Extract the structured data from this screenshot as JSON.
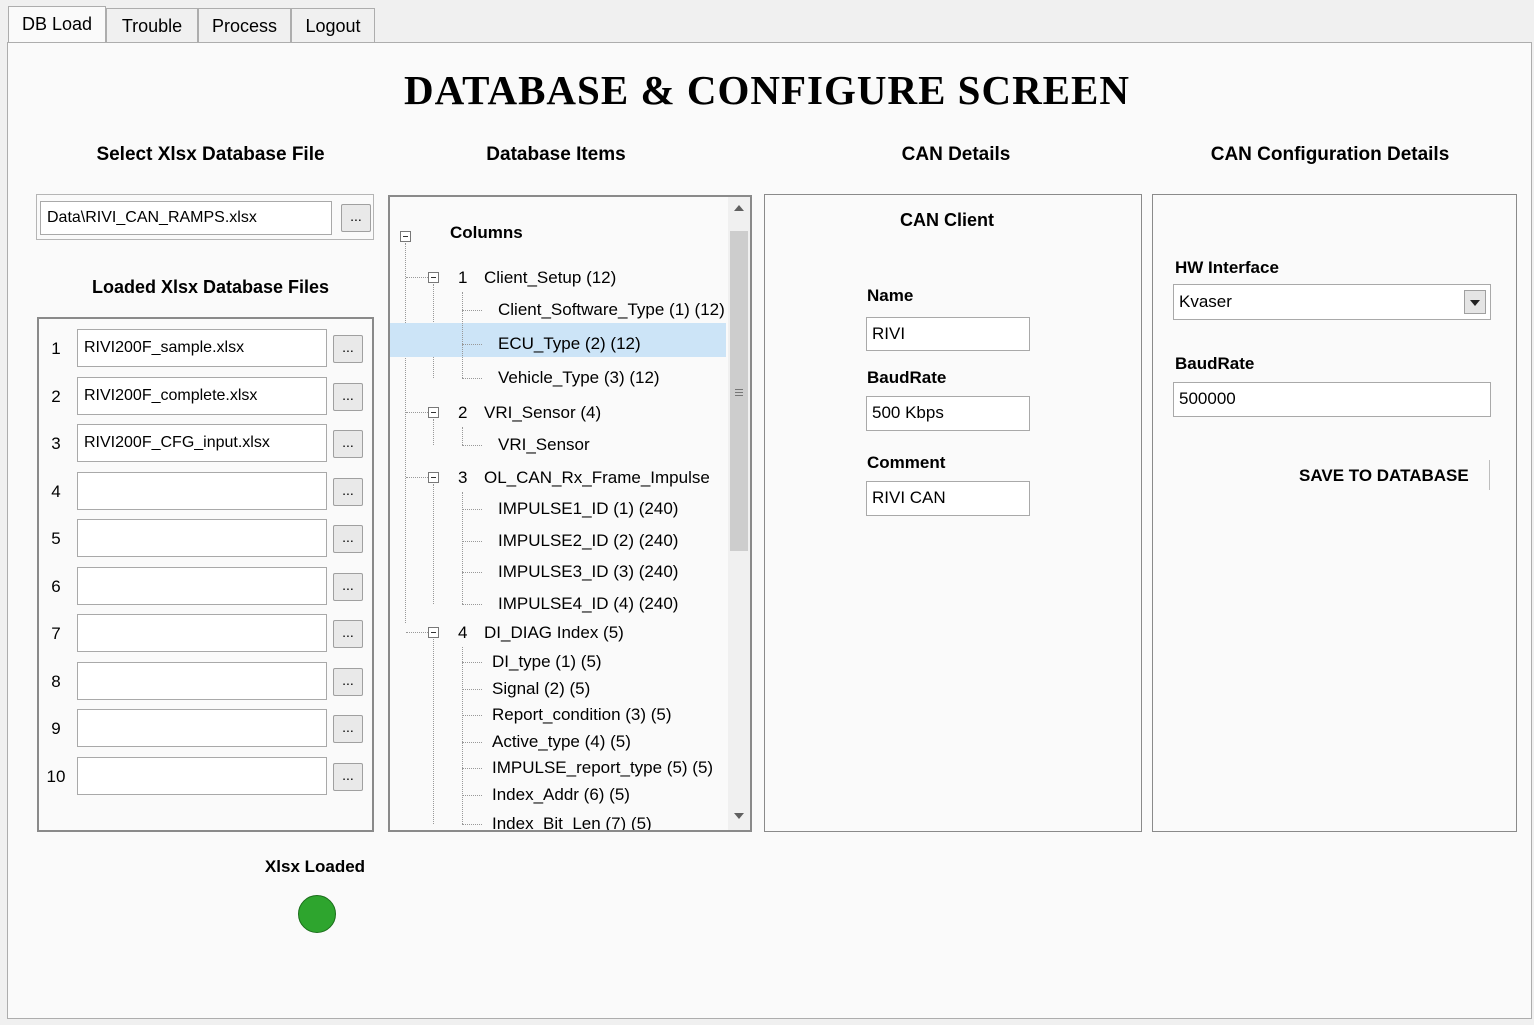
{
  "tabs": [
    "DB Load",
    "Trouble",
    "Process",
    "Logout"
  ],
  "title": "DATABASE & CONFIGURE SCREEN",
  "headers": {
    "select_file": "Select Xlsx Database File",
    "db_items": "Database Items",
    "can_details": "CAN Details",
    "can_config": "CAN Configuration Details"
  },
  "file_select": {
    "path": "Data\\RIVI_CAN_RAMPS.xlsx",
    "browse": "..."
  },
  "loaded": {
    "title": "Loaded Xlsx Database Files",
    "rows": [
      {
        "n": "1",
        "file": "RIVI200F_sample.xlsx"
      },
      {
        "n": "2",
        "file": "RIVI200F_complete.xlsx"
      },
      {
        "n": "3",
        "file": "RIVI200F_CFG_input.xlsx"
      },
      {
        "n": "4",
        "file": ""
      },
      {
        "n": "5",
        "file": ""
      },
      {
        "n": "6",
        "file": ""
      },
      {
        "n": "7",
        "file": ""
      },
      {
        "n": "8",
        "file": ""
      },
      {
        "n": "9",
        "file": ""
      },
      {
        "n": "10",
        "file": ""
      }
    ],
    "browse": "..."
  },
  "status": {
    "label": "Xlsx Loaded",
    "color": "#2ea52e"
  },
  "tree": {
    "root": "Columns",
    "groups": [
      {
        "num": "1",
        "label": "Client_Setup (12)",
        "children": [
          "Client_Software_Type (1) (12)",
          "ECU_Type (2) (12)",
          "Vehicle_Type (3) (12)"
        ]
      },
      {
        "num": "2",
        "label": "VRI_Sensor (4)",
        "children": [
          "VRI_Sensor"
        ]
      },
      {
        "num": "3",
        "label": "OL_CAN_Rx_Frame_Impulse",
        "children": [
          "IMPULSE1_ID (1) (240)",
          "IMPULSE2_ID (2) (240)",
          "IMPULSE3_ID (3) (240)",
          "IMPULSE4_ID (4) (240)"
        ]
      },
      {
        "num": "4",
        "label": "DI_DIAG Index (5)",
        "children": [
          "DI_type (1) (5)",
          "Signal (2) (5)",
          "Report_condition (3) (5)",
          "Active_type (4) (5)",
          "IMPULSE_report_type (5) (5)",
          "Index_Addr (6) (5)",
          "Index_Bit_Len (7) (5)"
        ]
      }
    ],
    "selected": "ECU_Type (2) (12)",
    "highlight_color": "#cce4f7"
  },
  "can_client": {
    "title": "CAN Client",
    "name_label": "Name",
    "name": "RIVI",
    "baud_label": "BaudRate",
    "baud": "500 Kbps",
    "comment_label": "Comment",
    "comment": "RIVI CAN"
  },
  "can_config": {
    "hw_label": "HW Interface",
    "hw": "Kvaser",
    "baud_label": "BaudRate",
    "baud": "500000",
    "save": "SAVE TO DATABASE"
  }
}
